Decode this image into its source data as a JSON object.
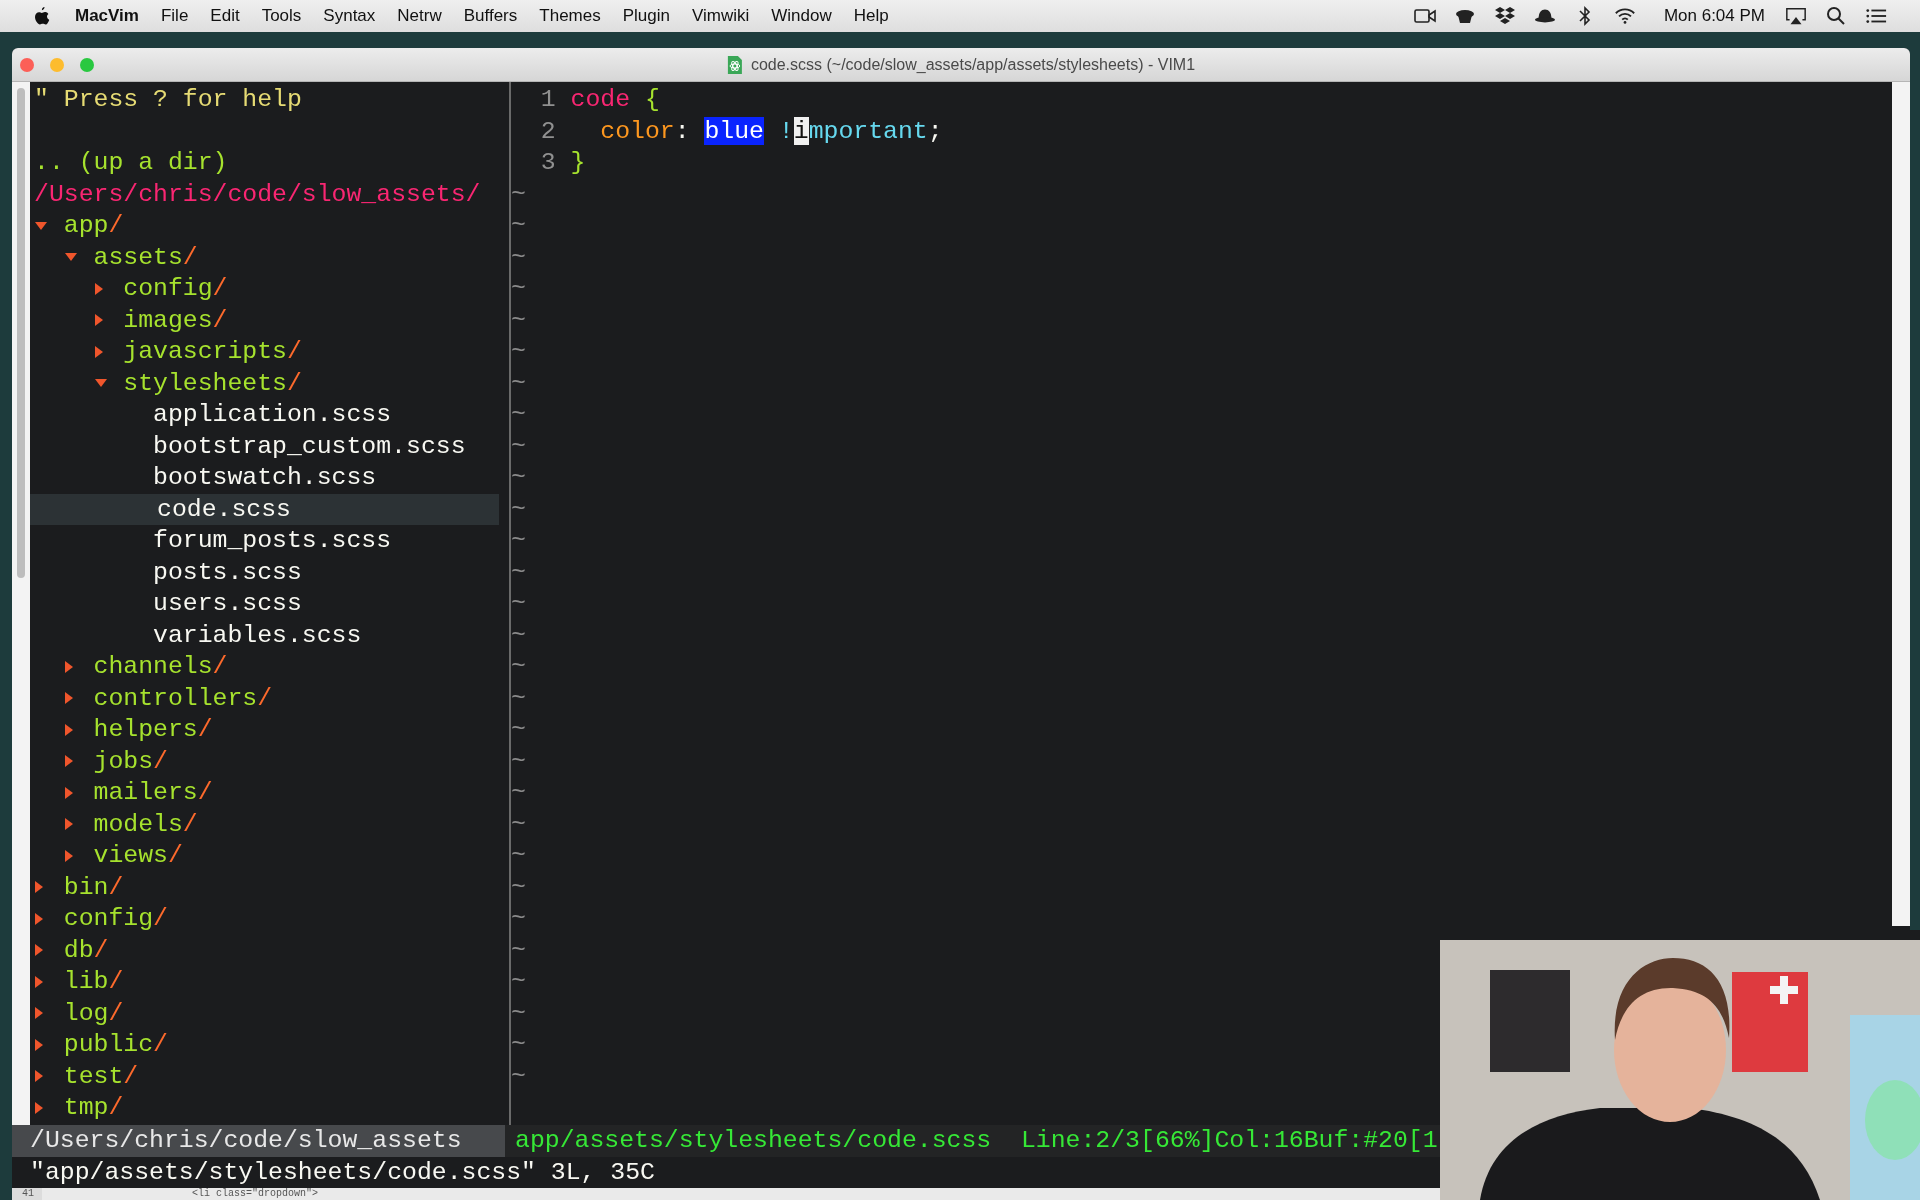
{
  "menu_bar": {
    "app": "MacVim",
    "menus": [
      "File",
      "Edit",
      "Tools",
      "Syntax",
      "Netrw",
      "Buffers",
      "Themes",
      "Plugin",
      "Vimwiki",
      "Window",
      "Help"
    ],
    "clock": "Mon 6:04 PM"
  },
  "window": {
    "title": "code.scss (~/code/slow_assets/app/assets/stylesheets) - VIM1"
  },
  "file_tree": {
    "help": "\" Press ? for help",
    "up": ".. (up a dir)",
    "root": "/Users/chris/code/slow_assets/",
    "items": [
      {
        "name": "app/",
        "kind": "dir",
        "expanded": true,
        "selected": false,
        "children": [
          {
            "name": "assets/",
            "kind": "dir",
            "expanded": true,
            "selected": false,
            "children": [
              {
                "name": "config/",
                "kind": "dir",
                "expanded": false,
                "selected": false
              },
              {
                "name": "images/",
                "kind": "dir",
                "expanded": false,
                "selected": false
              },
              {
                "name": "javascripts/",
                "kind": "dir",
                "expanded": false,
                "selected": false
              },
              {
                "name": "stylesheets/",
                "kind": "dir",
                "expanded": true,
                "selected": false,
                "children": [
                  {
                    "name": "application.scss",
                    "kind": "file",
                    "selected": false
                  },
                  {
                    "name": "bootstrap_custom.scss",
                    "kind": "file",
                    "selected": false
                  },
                  {
                    "name": "bootswatch.scss",
                    "kind": "file",
                    "selected": false
                  },
                  {
                    "name": "code.scss",
                    "kind": "file",
                    "selected": true
                  },
                  {
                    "name": "forum_posts.scss",
                    "kind": "file",
                    "selected": false
                  },
                  {
                    "name": "posts.scss",
                    "kind": "file",
                    "selected": false
                  },
                  {
                    "name": "users.scss",
                    "kind": "file",
                    "selected": false
                  },
                  {
                    "name": "variables.scss",
                    "kind": "file",
                    "selected": false
                  }
                ]
              }
            ]
          },
          {
            "name": "channels/",
            "kind": "dir",
            "expanded": false,
            "selected": false
          },
          {
            "name": "controllers/",
            "kind": "dir",
            "expanded": false,
            "selected": false
          },
          {
            "name": "helpers/",
            "kind": "dir",
            "expanded": false,
            "selected": false
          },
          {
            "name": "jobs/",
            "kind": "dir",
            "expanded": false,
            "selected": false
          },
          {
            "name": "mailers/",
            "kind": "dir",
            "expanded": false,
            "selected": false
          },
          {
            "name": "models/",
            "kind": "dir",
            "expanded": false,
            "selected": false
          },
          {
            "name": "views/",
            "kind": "dir",
            "expanded": false,
            "selected": false
          }
        ]
      },
      {
        "name": "bin/",
        "kind": "dir",
        "expanded": false,
        "selected": false
      },
      {
        "name": "config/",
        "kind": "dir",
        "expanded": false,
        "selected": false
      },
      {
        "name": "db/",
        "kind": "dir",
        "expanded": false,
        "selected": false
      },
      {
        "name": "lib/",
        "kind": "dir",
        "expanded": false,
        "selected": false
      },
      {
        "name": "log/",
        "kind": "dir",
        "expanded": false,
        "selected": false
      },
      {
        "name": "public/",
        "kind": "dir",
        "expanded": false,
        "selected": false
      },
      {
        "name": "test/",
        "kind": "dir",
        "expanded": false,
        "selected": false
      },
      {
        "name": "tmp/",
        "kind": "dir",
        "expanded": false,
        "selected": false
      }
    ]
  },
  "editor": {
    "lines": [
      {
        "number": "1",
        "indented": false,
        "tokens": [
          {
            "kind": "tag",
            "text": "code "
          },
          {
            "kind": "brace",
            "text": "{"
          }
        ]
      },
      {
        "number": "2",
        "indented": true,
        "tokens": [
          {
            "kind": "property",
            "text": "color"
          },
          {
            "kind": "text",
            "text": ": "
          },
          {
            "kind": "search",
            "text": "blue"
          },
          {
            "kind": "keyword",
            "text": " !"
          },
          {
            "kind": "cursor",
            "text": "i"
          },
          {
            "kind": "keyword",
            "text": "mportant"
          },
          {
            "kind": "text",
            "text": ";"
          }
        ]
      },
      {
        "number": "3",
        "indented": false,
        "tokens": [
          {
            "kind": "brace",
            "text": "}"
          }
        ]
      }
    ],
    "filler_rows": [
      "~",
      "~",
      "~",
      "~",
      "~",
      "~",
      "~",
      "~",
      "~",
      "~",
      "~",
      "~",
      "~",
      "~",
      "~",
      "~",
      "~",
      "~",
      "~",
      "~",
      "~",
      "~",
      "~",
      "~",
      "~",
      "~",
      "~",
      "~",
      "~"
    ]
  },
  "status_line": {
    "directory": "/Users/chris/code/slow_assets",
    "file": "app/assets/stylesheets/code.scss",
    "position": "Line:2/3[66%]Col:16Buf:#20[1"
  },
  "message": "\"app/assets/stylesheets/code.scss\" 3L, 35C",
  "background_window": {
    "line_number": "41",
    "code": "<li class=\"dropdown\">"
  }
}
